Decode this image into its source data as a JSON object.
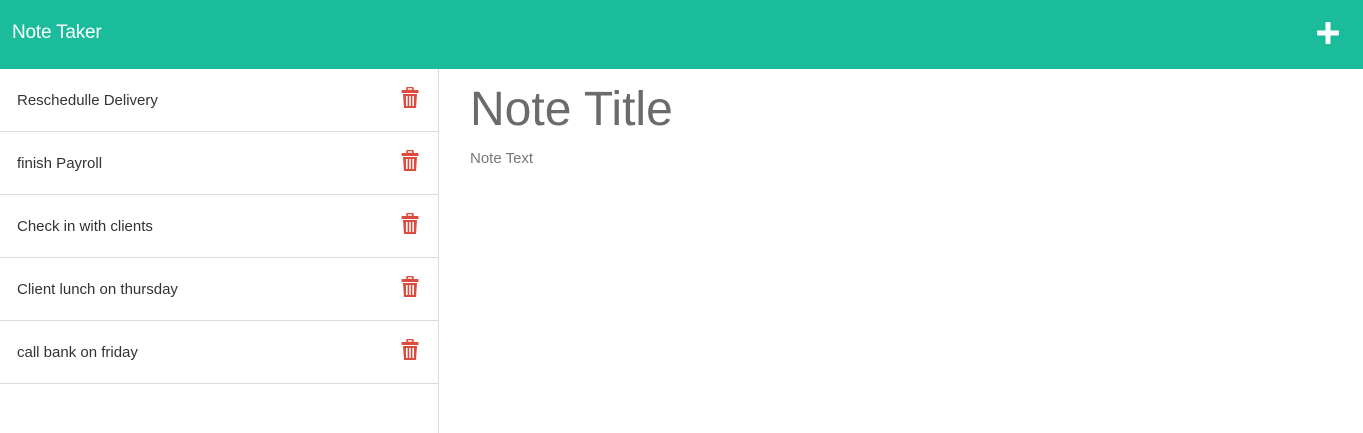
{
  "navbar": {
    "brand": "Note Taker",
    "new_note_icon": "plus-icon",
    "color": "#1abc9c"
  },
  "sidebar": {
    "notes": [
      {
        "title": "Reschedulle Delivery",
        "delete_icon": "trash-icon"
      },
      {
        "title": "finish Payroll",
        "delete_icon": "trash-icon"
      },
      {
        "title": "Check in with clients",
        "delete_icon": "trash-icon"
      },
      {
        "title": "Client lunch on thursday",
        "delete_icon": "trash-icon"
      },
      {
        "title": "call bank on friday",
        "delete_icon": "trash-icon"
      }
    ],
    "delete_color": "#dc4b3c"
  },
  "editor": {
    "title_placeholder": "Note Title",
    "text_placeholder": "Note Text",
    "title_value": "",
    "text_value": ""
  }
}
